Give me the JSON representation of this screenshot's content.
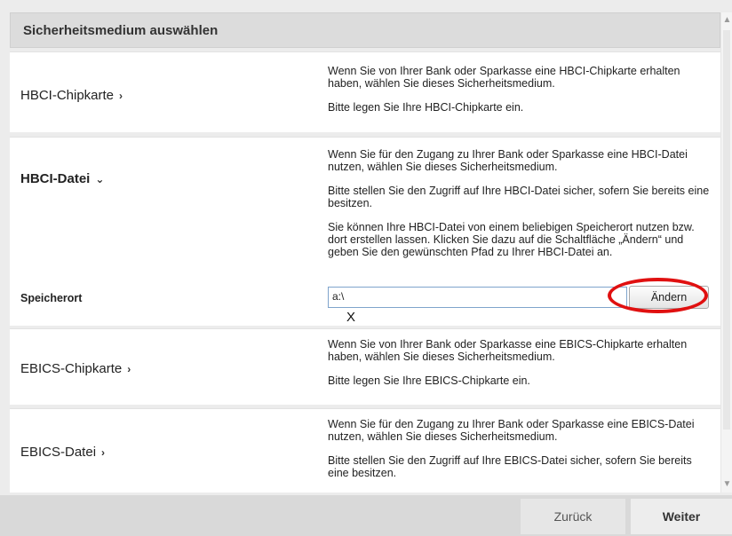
{
  "header": {
    "title": "Sicherheitsmedium auswählen"
  },
  "options": [
    {
      "label": "HBCI-Chipkarte",
      "chevron": "›",
      "desc": [
        "Wenn Sie von Ihrer Bank oder Sparkasse eine HBCI-Chipkarte erhalten haben, wählen Sie dieses Sicherheitsmedium.",
        "Bitte legen Sie Ihre HBCI-Chipkarte ein."
      ]
    },
    {
      "label": "HBCI-Datei",
      "chevron": "⌄",
      "desc": [
        "Wenn Sie für den Zugang zu Ihrer Bank oder Sparkasse eine HBCI-Datei nutzen, wählen Sie dieses Sicherheitsmedium.",
        "Bitte stellen Sie den Zugriff auf Ihre HBCI-Datei sicher, sofern Sie bereits eine besitzen.",
        "Sie können Ihre HBCI-Datei von einem beliebigen Speicherort nutzen bzw. dort erstellen lassen. Klicken Sie dazu auf die Schaltfläche „Ändern“ und geben Sie den gewünschten Pfad zu Ihrer HBCI-Datei an."
      ],
      "field_label": "Speicherort",
      "field_value": "a:\\",
      "change_label": "Ändern",
      "cursor_mark": "X"
    },
    {
      "label": "EBICS-Chipkarte",
      "chevron": "›",
      "desc": [
        "Wenn Sie von Ihrer Bank oder Sparkasse eine EBICS-Chipkarte erhalten haben, wählen Sie dieses Sicherheitsmedium.",
        "Bitte legen Sie Ihre EBICS-Chipkarte ein."
      ]
    },
    {
      "label": "EBICS-Datei",
      "chevron": "›",
      "desc": [
        "Wenn Sie für den Zugang zu Ihrer Bank oder Sparkasse eine EBICS-Datei nutzen, wählen Sie dieses Sicherheitsmedium.",
        "Bitte stellen Sie den Zugriff auf Ihre EBICS-Datei sicher, sofern Sie bereits eine besitzen."
      ]
    }
  ],
  "footer": {
    "back_label": "Zurück",
    "next_label": "Weiter"
  },
  "colors": {
    "highlight": "#e01010",
    "input_border": "#7fa4cc"
  }
}
